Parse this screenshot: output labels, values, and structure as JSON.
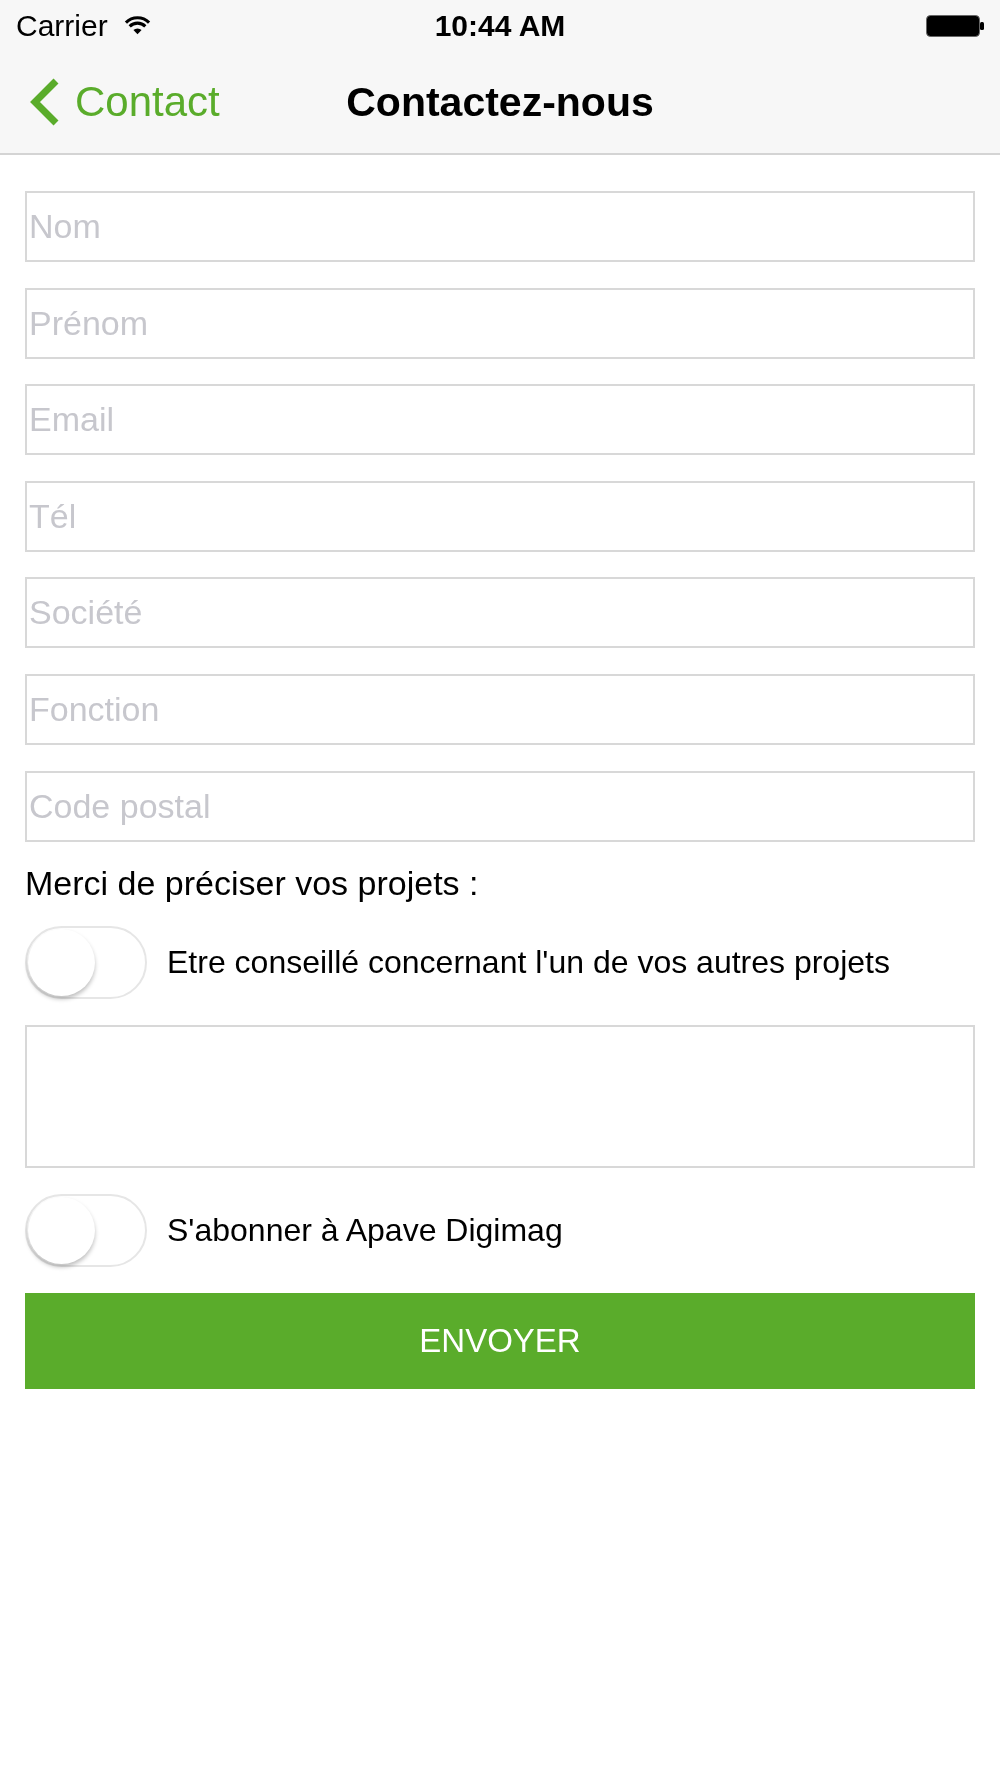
{
  "status_bar": {
    "carrier": "Carrier",
    "time": "10:44 AM"
  },
  "nav_bar": {
    "back_label": "Contact",
    "title": "Contactez-nous"
  },
  "form": {
    "fields": [
      {
        "placeholder": "Nom"
      },
      {
        "placeholder": "Prénom"
      },
      {
        "placeholder": "Email"
      },
      {
        "placeholder": "Tél"
      },
      {
        "placeholder": "Société"
      },
      {
        "placeholder": "Fonction"
      },
      {
        "placeholder": "Code postal"
      }
    ],
    "projects_label": "Merci de préciser vos projets :",
    "items": [
      {
        "kind": "toggle",
        "label": "Etre conseillé concernant l'un de vos autres projets",
        "on": false
      },
      {
        "kind": "text_area"
      },
      {
        "kind": "toggle",
        "label": "S'abonner à Apave Digimag",
        "on": false
      }
    ],
    "submit": "ENVOYER"
  }
}
